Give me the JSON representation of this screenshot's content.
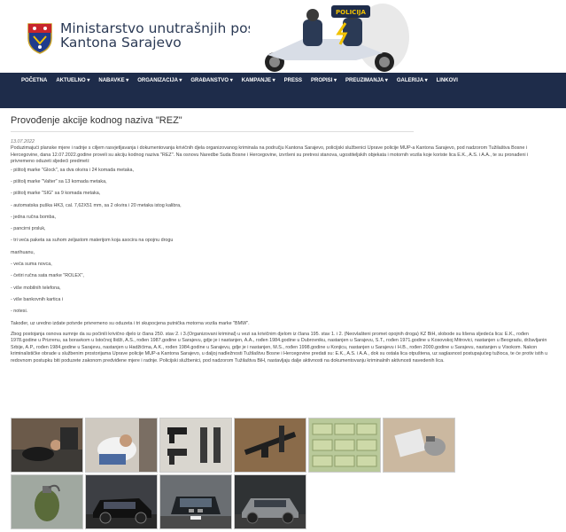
{
  "header": {
    "title_line1": "Ministarstvo unutrašnjih poslova",
    "title_line2": "Kantona Sarajevo",
    "hero_badge": "POLICIJA"
  },
  "nav": {
    "items": [
      {
        "label": "POČETNA"
      },
      {
        "label": "AKTUELNO ▾"
      },
      {
        "label": "NABAVKE ▾"
      },
      {
        "label": "ORGANIZACIJA ▾"
      },
      {
        "label": "GRAĐANSTVO ▾"
      },
      {
        "label": "KAMPANJE ▾"
      },
      {
        "label": "PRESS"
      },
      {
        "label": "PROPISI ▾"
      },
      {
        "label": "PREUZIMANJA ▾"
      },
      {
        "label": "GALERIJA ▾"
      },
      {
        "label": "LINKOVI"
      }
    ]
  },
  "article": {
    "title": "Provođenje akcije kodnog naziva \"REZ\"",
    "date": "13.07.2022",
    "intro": "Poduzimajući planske mjere i radnje s ciljem rasvjetljavanja i dokumentovanja krivičnih djela organizovanog kriminala na području Kantona Sarajevo, policijski službenici Uprave policije MUP-a Kantona Sarajevo, pod nadzorom Tužilaštva Bosne i Hercegovine, dana 12.07.2022.godine proveli su akciju kodnog naziva \"REZ\". Na osnovu Naredbe Suda Bosne i Hercegovine, izvršeni su pretresi stanova, ugostiteljskih objekata i motornih vozila koje koriste lica E.K., A.S. i A.A., te su pronađeni i privremeno oduzeti sljedeći predmeti:",
    "items": [
      "- pištolj marke \"Glock\", sa dva okvira i 24 komada metaka,",
      "- pištolj marke \"Valter\" sa 13 komada metaka,",
      "- pištolj marke \"SIG\" sa 9 komada metaka,",
      "- automatska puška HK3, cal. 7,62X51 mm, sa 2 okvira i 20 metaka istog kalibra,",
      "- jedna ručna bomba,",
      "- pancirni prsluk,",
      "- tri veća paketa sa suhom zeljastom materijom koja asocira na opojnu drogu",
      "marihuanu,",
      "- veća suma novca,",
      "- četiri ručna sata marke \"ROLEX\",",
      "- više mobilnih telefona,",
      "- više bankovnih kartica i",
      "- notesi."
    ],
    "tail": "Također, uz uredno izdate potvrde privremeno su oduzeta i tri skupocjena putnička motorna vozila marke \"BMW\".",
    "final": "Zbog postojanja osnova sumnje da su počinili krivično djelo iz člana 250. stav 2. i 3.(Organizovani kriminal) u vezi sa krivičnim djelom iz člana 195. stav 1. i 2. (Neovlašteni promet opojnih droga) KZ BiH, slobode su lišena sljedeća lica: E.K., rođen 1978.godine u Prizrenu, sa boravkom u Istočnoj Ilidži, A.S., rođen 1987.godine u Sarajevu, gdje je i nastanjen, A.A., rođen 1984.godine u Dubrovniku, nastanjen u Sarajevu, S.T., rođen 1971.godine u Kosovskoj Mitrovici, nastanjen u Beogradu, državljanin Srbije, A.P., rođen 1984.godine u Sarajevu, nastanjen u Hadžićima, A.K., rođen 1984.godine u Sarajevu, gdje je i nastanjen, M.S., rođen 1998.godine u Konjicu, nastanjen u Sarajevu i H.B., rođen 2000.godine u Sarajevu, nastanjen u Visokom. Nakon kriminalističke obrade u službenim prostorijama Uprave policije MUP-a Kantona Sarajevo, u daljoj nadležnosti Tužilaštvu Bosne i Hercegovine predati su: E.K., A.S. i A.A., dok su ostala lica otpuštena, uz saglasnost postupajućeg tužioca, te će protiv istih u redovnom postupku biti poduzete zakonom predviđene mjere i radnje. Policijski službenici, pod nadzorom Tužilaštva BiH, nastavljaju dalje aktivnosti na dokumentovanju kriminalnih aktivnosti navedenih lica."
  },
  "gallery": {
    "photos": [
      {
        "name": "photo-arrest-floor"
      },
      {
        "name": "photo-detained-person"
      },
      {
        "name": "photo-pistols"
      },
      {
        "name": "photo-rifle"
      },
      {
        "name": "photo-money"
      },
      {
        "name": "photo-package"
      },
      {
        "name": "photo-hand-grenade"
      },
      {
        "name": "photo-bmw-dark"
      },
      {
        "name": "photo-bmw-front"
      },
      {
        "name": "photo-bmw-grey"
      }
    ]
  },
  "colors": {
    "nav_bg": "#1e2c4a",
    "title_text": "#2b3a55"
  }
}
